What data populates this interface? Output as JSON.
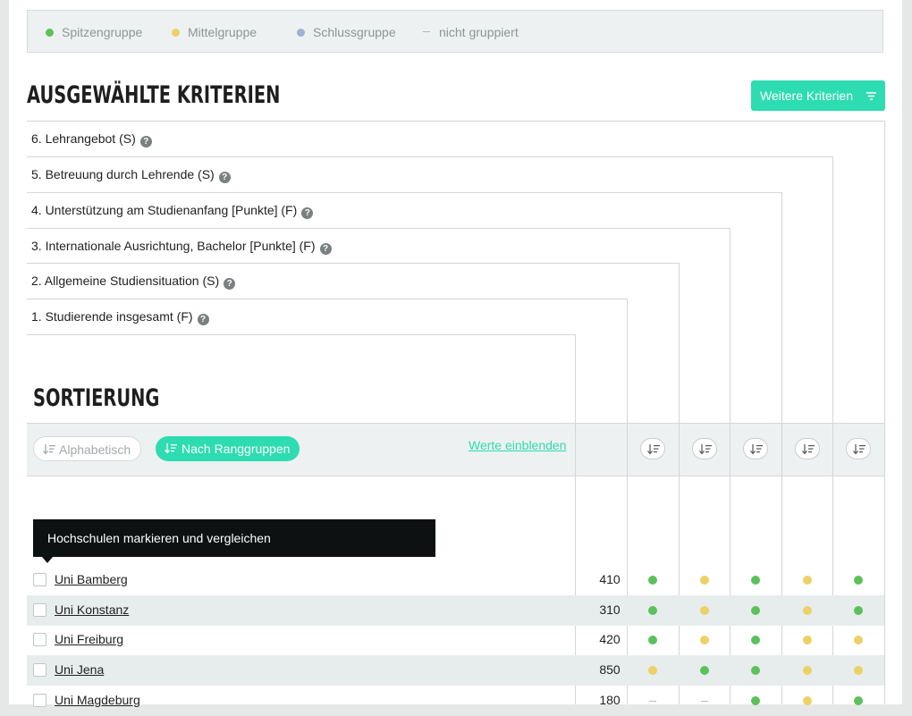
{
  "colors": {
    "top": "#5cc15c",
    "mid": "#ecd167",
    "bottom": "#9db3d6",
    "accent": "#2ddcb0"
  },
  "legend": {
    "top": "Spitzengruppe",
    "mid": "Mittelgruppe",
    "bottom": "Schlussgruppe",
    "none": "nicht gruppiert"
  },
  "criteria_section": {
    "title": "AUSGEWÄHLTE KRITERIEN",
    "more_button": "Weitere Kriterien",
    "items": [
      "6. Lehrangebot (S)",
      "5. Betreuung durch Lehrende (S)",
      "4. Unterstützung am Studienanfang [Punkte] (F)",
      "3. Internationale Ausrichtung, Bachelor [Punkte] (F)",
      "2. Allgemeine Studiensituation (S)",
      "1. Studierende insgesamt (F)"
    ]
  },
  "sorting": {
    "title": "SORTIERUNG",
    "alpha_label": "Alphabetisch",
    "rank_label": "Nach Ranggruppen",
    "show_values_link": "Werte einblenden"
  },
  "tooltip": "Hochschulen markieren und vergleichen",
  "rows": [
    {
      "name": "Uni Bamberg",
      "value": "410",
      "groups": [
        "top",
        "mid",
        "top",
        "mid",
        "top"
      ]
    },
    {
      "name": "Uni Konstanz",
      "value": "310",
      "groups": [
        "top",
        "mid",
        "top",
        "mid",
        "top"
      ]
    },
    {
      "name": "Uni Freiburg",
      "value": "420",
      "groups": [
        "top",
        "mid",
        "top",
        "mid",
        "mid"
      ]
    },
    {
      "name": "Uni Jena",
      "value": "850",
      "groups": [
        "mid",
        "top",
        "top",
        "mid",
        "mid"
      ]
    },
    {
      "name": "Uni Magdeburg",
      "value": "180",
      "groups": [
        "none",
        "none",
        "top",
        "mid",
        "top"
      ]
    }
  ]
}
